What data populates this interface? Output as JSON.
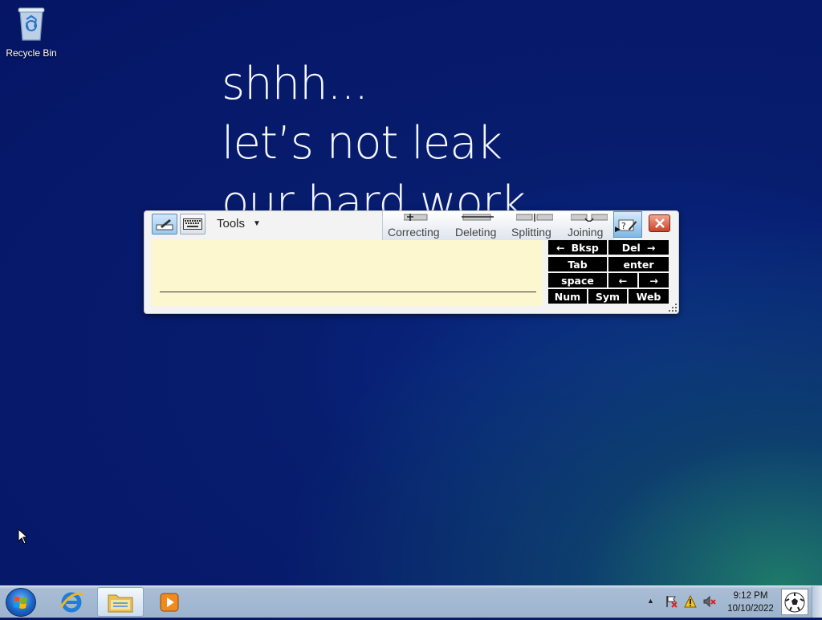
{
  "desktop": {
    "recycle_bin_label": "Recycle Bin",
    "wallpaper_lines": [
      "shhh...",
      "let’s not leak",
      "our hard work"
    ]
  },
  "input_panel": {
    "tools_label": "Tools",
    "gestures": [
      "Correcting",
      "Deleting",
      "Splitting",
      "Joining"
    ],
    "keys": {
      "bksp": "Bksp",
      "del": "Del",
      "tab": "Tab",
      "enter": "enter",
      "space": "space",
      "num": "Num",
      "sym": "Sym",
      "web": "Web"
    },
    "colors": {
      "pad": "#fdf7cf",
      "key": "#000000"
    }
  },
  "taskbar": {
    "pinned": [
      "start-button",
      "internet-explorer",
      "windows-explorer",
      "media-player"
    ],
    "clock_time": "9:12 PM",
    "clock_date": "10/10/2022"
  }
}
